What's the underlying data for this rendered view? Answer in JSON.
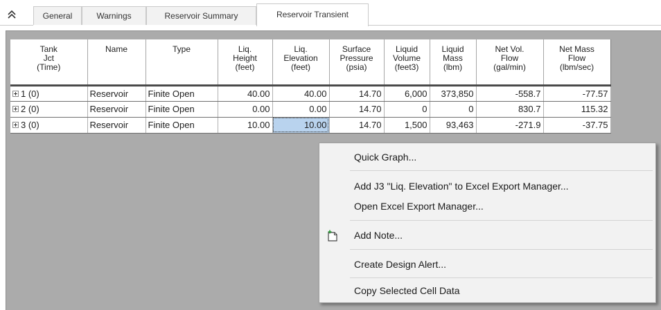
{
  "tabs": [
    {
      "label": "General"
    },
    {
      "label": "Warnings"
    },
    {
      "label": "Reservoir Summary"
    },
    {
      "label": "Reservoir Transient"
    }
  ],
  "active_tab": "Reservoir Transient",
  "table": {
    "headers": [
      "Tank\nJct\n(Time)",
      "Name",
      "Type",
      "Liq.\nHeight\n(feet)",
      "Liq.\nElevation\n(feet)",
      "Surface\nPressure\n(psia)",
      "Liquid\nVolume\n(feet3)",
      "Liquid\nMass\n(lbm)",
      "Net Vol.\nFlow\n(gal/min)",
      "Net Mass\nFlow\n(lbm/sec)"
    ],
    "rows": [
      [
        "1 (0)",
        "Reservoir",
        "Finite Open",
        "40.00",
        "40.00",
        "14.70",
        "6,000",
        "373,850",
        "-558.7",
        "-77.57"
      ],
      [
        "2 (0)",
        "Reservoir",
        "Finite Open",
        "0.00",
        "0.00",
        "14.70",
        "0",
        "0",
        "830.7",
        "115.32"
      ],
      [
        "3 (0)",
        "Reservoir",
        "Finite Open",
        "10.00",
        "10.00",
        "14.70",
        "1,500",
        "93,463",
        "-271.9",
        "-37.75"
      ]
    ]
  },
  "context_menu": {
    "items": [
      {
        "label": "Quick Graph..."
      },
      {
        "label": "Add J3 \"Liq. Elevation\" to Excel Export Manager..."
      },
      {
        "label": "Open Excel Export Manager..."
      },
      {
        "label": "Add Note...",
        "icon": "add-note-icon"
      },
      {
        "label": "Create Design Alert..."
      },
      {
        "label": "Copy Selected Cell Data"
      }
    ]
  },
  "colors": {
    "panel_bg": "#ababab",
    "selected_cell": "#b9d3ee",
    "menu_bg": "#f2f2f2",
    "note_icon_plus": "#2e9a3a"
  }
}
